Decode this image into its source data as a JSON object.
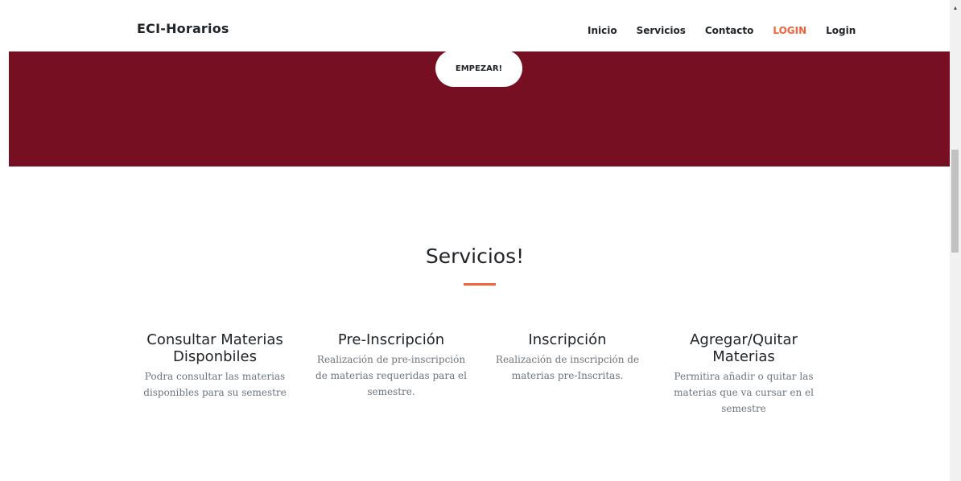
{
  "navbar": {
    "brand": "ECI-Horarios",
    "links": [
      {
        "label": "Inicio",
        "active": false
      },
      {
        "label": "Servicios",
        "active": false
      },
      {
        "label": "Contacto",
        "active": false
      },
      {
        "label": "LOGIN",
        "active": true
      },
      {
        "label": "Login",
        "active": false
      }
    ]
  },
  "hero": {
    "cta_label": "EMPEZAR!",
    "background_color": "#760f21"
  },
  "services": {
    "title": "Servicios!",
    "accent_color": "#f4623a",
    "items": [
      {
        "title": "Consultar Materias Disponbiles",
        "description": "Podra consultar las materias disponibles para su semestre"
      },
      {
        "title": "Pre-Inscripción",
        "description": "Realización de pre-inscripción de materias requeridas para el semestre."
      },
      {
        "title": "Inscripción",
        "description": "Realización de inscripción de materias pre-Inscritas."
      },
      {
        "title": "Agregar/Quitar Materias",
        "description": "Permitira añadir o quitar las materias que va cursar en el semestre"
      }
    ]
  }
}
